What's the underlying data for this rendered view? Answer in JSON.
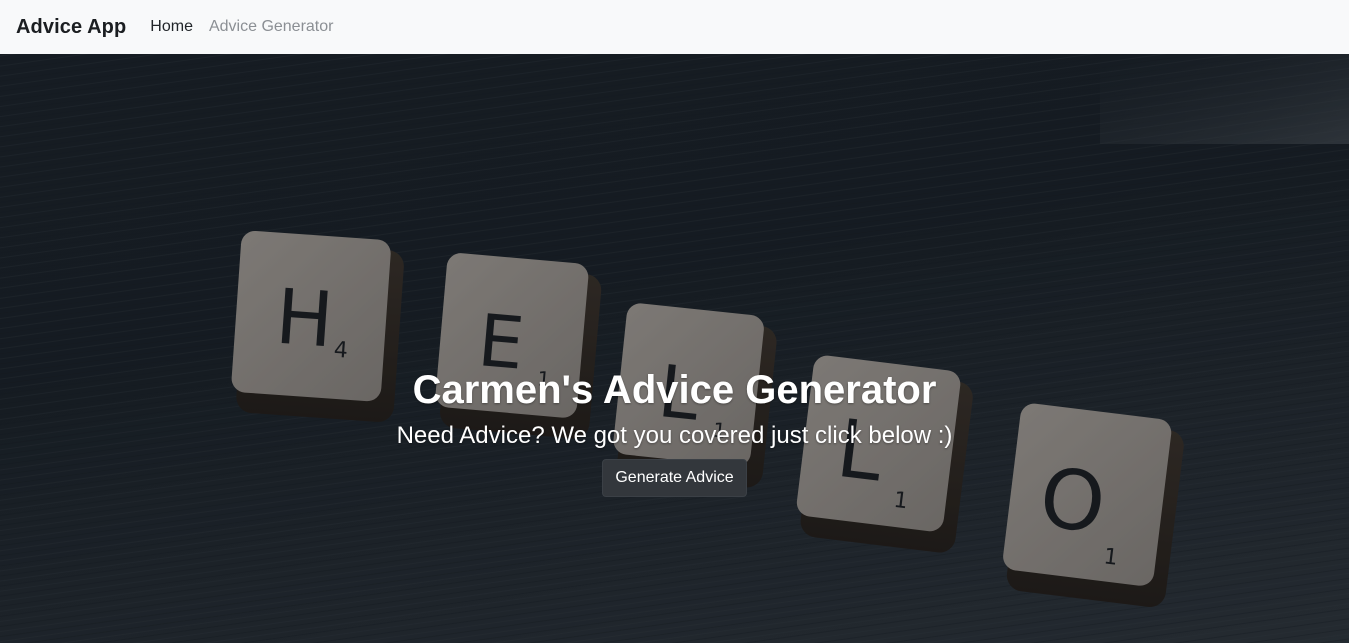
{
  "navbar": {
    "brand": "Advice App",
    "links": [
      {
        "label": "Home",
        "state": "active"
      },
      {
        "label": "Advice Generator",
        "state": "inactive"
      }
    ]
  },
  "hero": {
    "title": "Carmen's Advice Generator",
    "subtitle": "Need Advice? We got you covered just click below :)",
    "button_label": "Generate Advice",
    "background_image": {
      "tiles": [
        {
          "letter": "H",
          "points": "4"
        },
        {
          "letter": "E",
          "points": "1"
        },
        {
          "letter": "L",
          "points": "1"
        },
        {
          "letter": "L",
          "points": "1"
        },
        {
          "letter": "O",
          "points": "1"
        }
      ]
    }
  },
  "colors": {
    "navbar_bg": "#f8f9fa",
    "hero_bg": "#1b2229",
    "button_bg": "#33373c",
    "text_light": "#ffffff",
    "nav_muted": "#8b8f94"
  }
}
